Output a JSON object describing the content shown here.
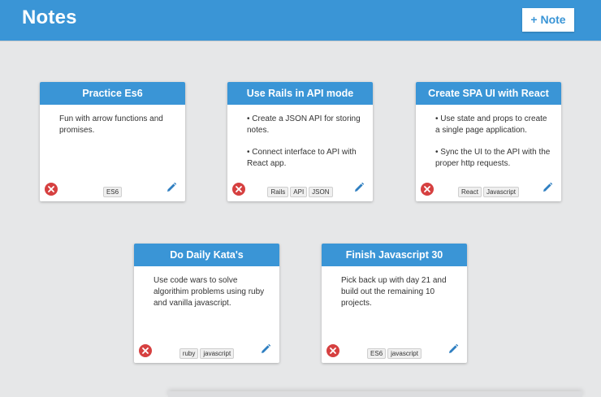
{
  "header": {
    "title": "Notes",
    "add_note_label": "+ Note"
  },
  "colors": {
    "accent": "#3a95d6",
    "delete": "#d64040",
    "background": "#e6e7e8"
  },
  "icons": {
    "delete": "x-circle-icon",
    "edit": "pencil-icon"
  },
  "notes": [
    {
      "title": "Practice Es6",
      "body": [
        "Fun with arrow functions and promises."
      ],
      "tags": [
        "ES6"
      ]
    },
    {
      "title": "Use Rails in API mode",
      "body": [
        "• Create a JSON API for storing notes.",
        "• Connect interface to API with React app."
      ],
      "tags": [
        "Rails",
        "API",
        "JSON"
      ]
    },
    {
      "title": "Create SPA UI with React",
      "body": [
        "• Use state and props to create a single page application.",
        "• Sync the UI to the API with the proper http requests."
      ],
      "tags": [
        "React",
        "Javascript"
      ]
    },
    {
      "title": "Do Daily Kata's",
      "body": [
        "Use code wars to solve algorithim problems using ruby and vanilla javascript."
      ],
      "tags": [
        "ruby",
        "javascript"
      ]
    },
    {
      "title": "Finish Javascript 30",
      "body": [
        "Pick back up with day 21 and build out the remaining 10 projects."
      ],
      "tags": [
        "ES6",
        "javascript"
      ]
    }
  ]
}
